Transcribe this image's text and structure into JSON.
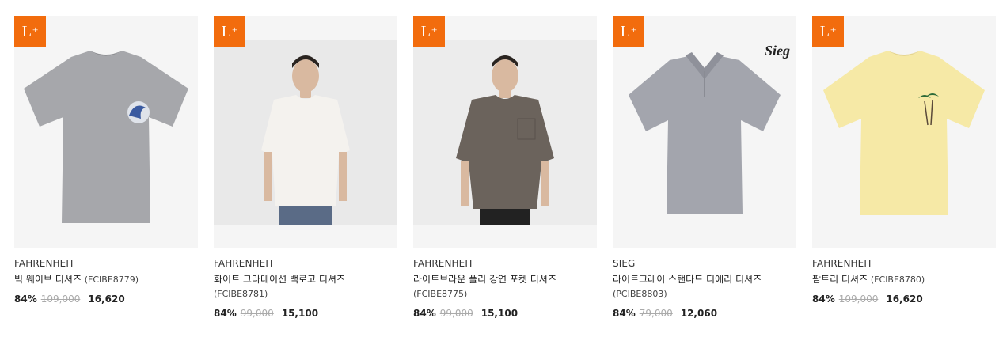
{
  "badge": {
    "label": "L",
    "sup": "+"
  },
  "products": [
    {
      "brand": "FAHRENHEIT",
      "name": "빅 웨이브 티셔즈",
      "code": "(FCIBE8779)",
      "discount": "84%",
      "original": "109,000",
      "price": "16,620"
    },
    {
      "brand": "FAHRENHEIT",
      "name": "화이트 그라데이션 백로고 티셔즈",
      "code": "(FCIBE8781)",
      "discount": "84%",
      "original": "99,000",
      "price": "15,100"
    },
    {
      "brand": "FAHRENHEIT",
      "name": "라이트브라운 폴리 강연 포켓 티셔즈",
      "code": "(FCIBE8775)",
      "discount": "84%",
      "original": "99,000",
      "price": "15,100"
    },
    {
      "brand": "SIEG",
      "name": "라이트그레이 스탠다드 티에리 티셔즈",
      "code": "(PCIBE8803)",
      "discount": "84%",
      "original": "79,000",
      "price": "12,060",
      "logo": "Sieg"
    },
    {
      "brand": "FAHRENHEIT",
      "name": "팜트리 티셔즈",
      "code": "(FCIBE8780)",
      "discount": "84%",
      "original": "109,000",
      "price": "16,620"
    }
  ],
  "colors": {
    "badge": "#f26c0d",
    "grey_tee": "#a6a7ab",
    "white_tee": "#f4f2ee",
    "brown_tee": "#6b635c",
    "polo": "#a3a5ad",
    "yellow_tee": "#f6e9a6"
  }
}
